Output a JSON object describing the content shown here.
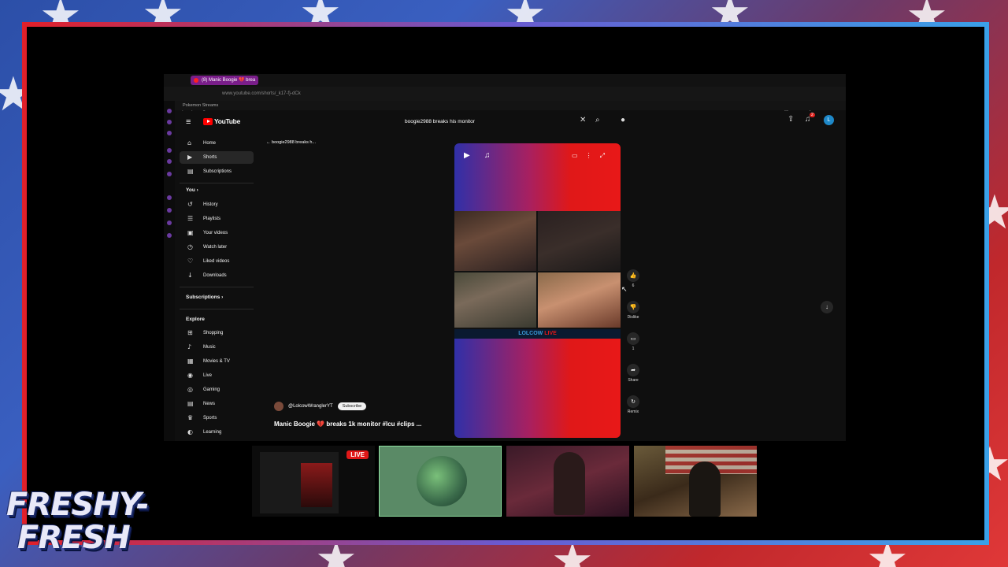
{
  "browser": {
    "tab_title": "(8) Manic Boogie 💔 brea",
    "url": "www.youtube.com/shorts/_k17-f}-dCk",
    "bookmark": "Pokemon Streams"
  },
  "youtube": {
    "logo_text": "YouTube",
    "search_query": "boogie2988 breaks his monitor",
    "notification_count": "2",
    "avatar_initial": "L"
  },
  "sidebar": {
    "items_top": [
      {
        "label": "Home",
        "icon": "home-icon"
      },
      {
        "label": "Shorts",
        "icon": "shorts-icon"
      },
      {
        "label": "Subscriptions",
        "icon": "subscriptions-icon"
      }
    ],
    "you_heading": "You",
    "you_items": [
      {
        "label": "History",
        "icon": "history-icon"
      },
      {
        "label": "Playlists",
        "icon": "playlists-icon"
      },
      {
        "label": "Your videos",
        "icon": "your-videos-icon"
      },
      {
        "label": "Watch later",
        "icon": "watch-later-icon"
      },
      {
        "label": "Liked videos",
        "icon": "liked-videos-icon"
      },
      {
        "label": "Downloads",
        "icon": "downloads-icon"
      }
    ],
    "subscriptions_heading": "Subscriptions",
    "explore_heading": "Explore",
    "explore_items": [
      {
        "label": "Shopping",
        "icon": "shopping-icon"
      },
      {
        "label": "Music",
        "icon": "music-icon"
      },
      {
        "label": "Movies & TV",
        "icon": "movies-icon"
      },
      {
        "label": "Live",
        "icon": "live-icon"
      },
      {
        "label": "Gaming",
        "icon": "gaming-icon"
      },
      {
        "label": "News",
        "icon": "news-icon"
      },
      {
        "label": "Sports",
        "icon": "sports-icon"
      },
      {
        "label": "Learning",
        "icon": "learning-icon"
      }
    ]
  },
  "short": {
    "back_label": "boogie2988 breaks h...",
    "channel": "@LolcowWranglerYT",
    "subscribe_label": "Subscribe",
    "title": "Manic Boogie 💔 breaks 1k monitor #lcu #clips ...",
    "overlay_text_a": "LOLCOW",
    "overlay_text_b": "LIVE",
    "like_count": "6",
    "dislike_label": "Dislike",
    "comment_count": "1",
    "share_label": "Share",
    "remix_label": "Remix"
  },
  "stream": {
    "live_badge": "LIVE",
    "logo_line1": "FRESHY-",
    "logo_line2": "FRESH"
  },
  "colors": {
    "accent_red": "#ff0000",
    "frame_red": "#e0202a",
    "frame_blue": "#3aa0e8",
    "active_cam_border": "#8fe0a0"
  }
}
